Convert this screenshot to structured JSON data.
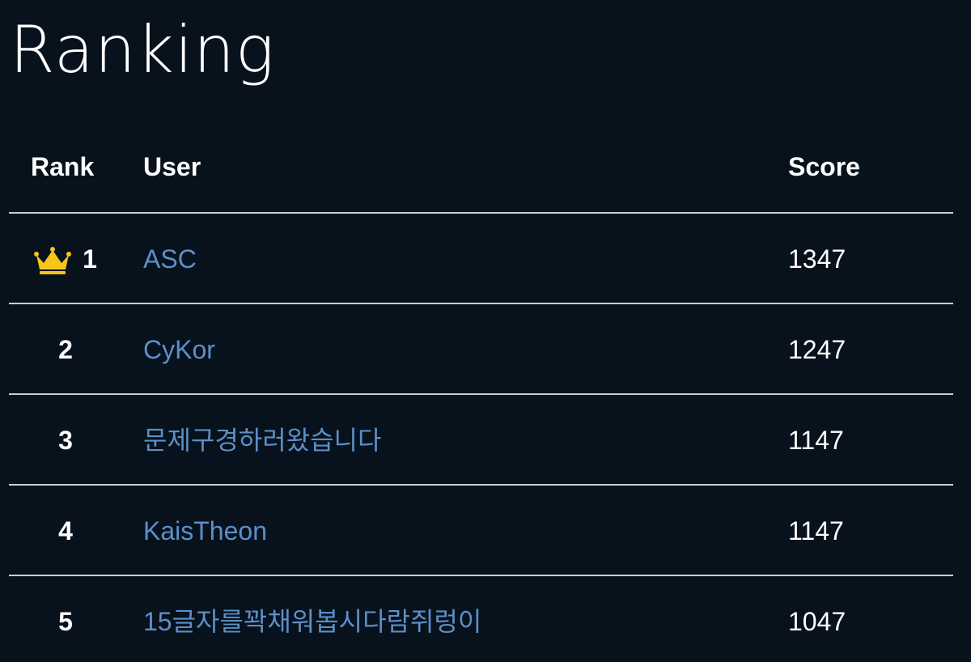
{
  "page": {
    "title": "Ranking"
  },
  "table": {
    "headers": {
      "rank": "Rank",
      "user": "User",
      "score": "Score"
    },
    "rows": [
      {
        "rank": "1",
        "user": "ASC",
        "score": "1347",
        "icon": "crown-icon"
      },
      {
        "rank": "2",
        "user": "CyKor",
        "score": "1247"
      },
      {
        "rank": "3",
        "user": "문제구경하러왔습니다",
        "score": "1147"
      },
      {
        "rank": "4",
        "user": "KaisTheon",
        "score": "1147"
      },
      {
        "rank": "5",
        "user": "15글자를꽉채워봅시다람쥐렁이",
        "score": "1047"
      }
    ]
  },
  "colors": {
    "background": "#08121c",
    "link": "#5b8fc8",
    "crown": "#f5c518",
    "divider": "#c9ced3"
  }
}
